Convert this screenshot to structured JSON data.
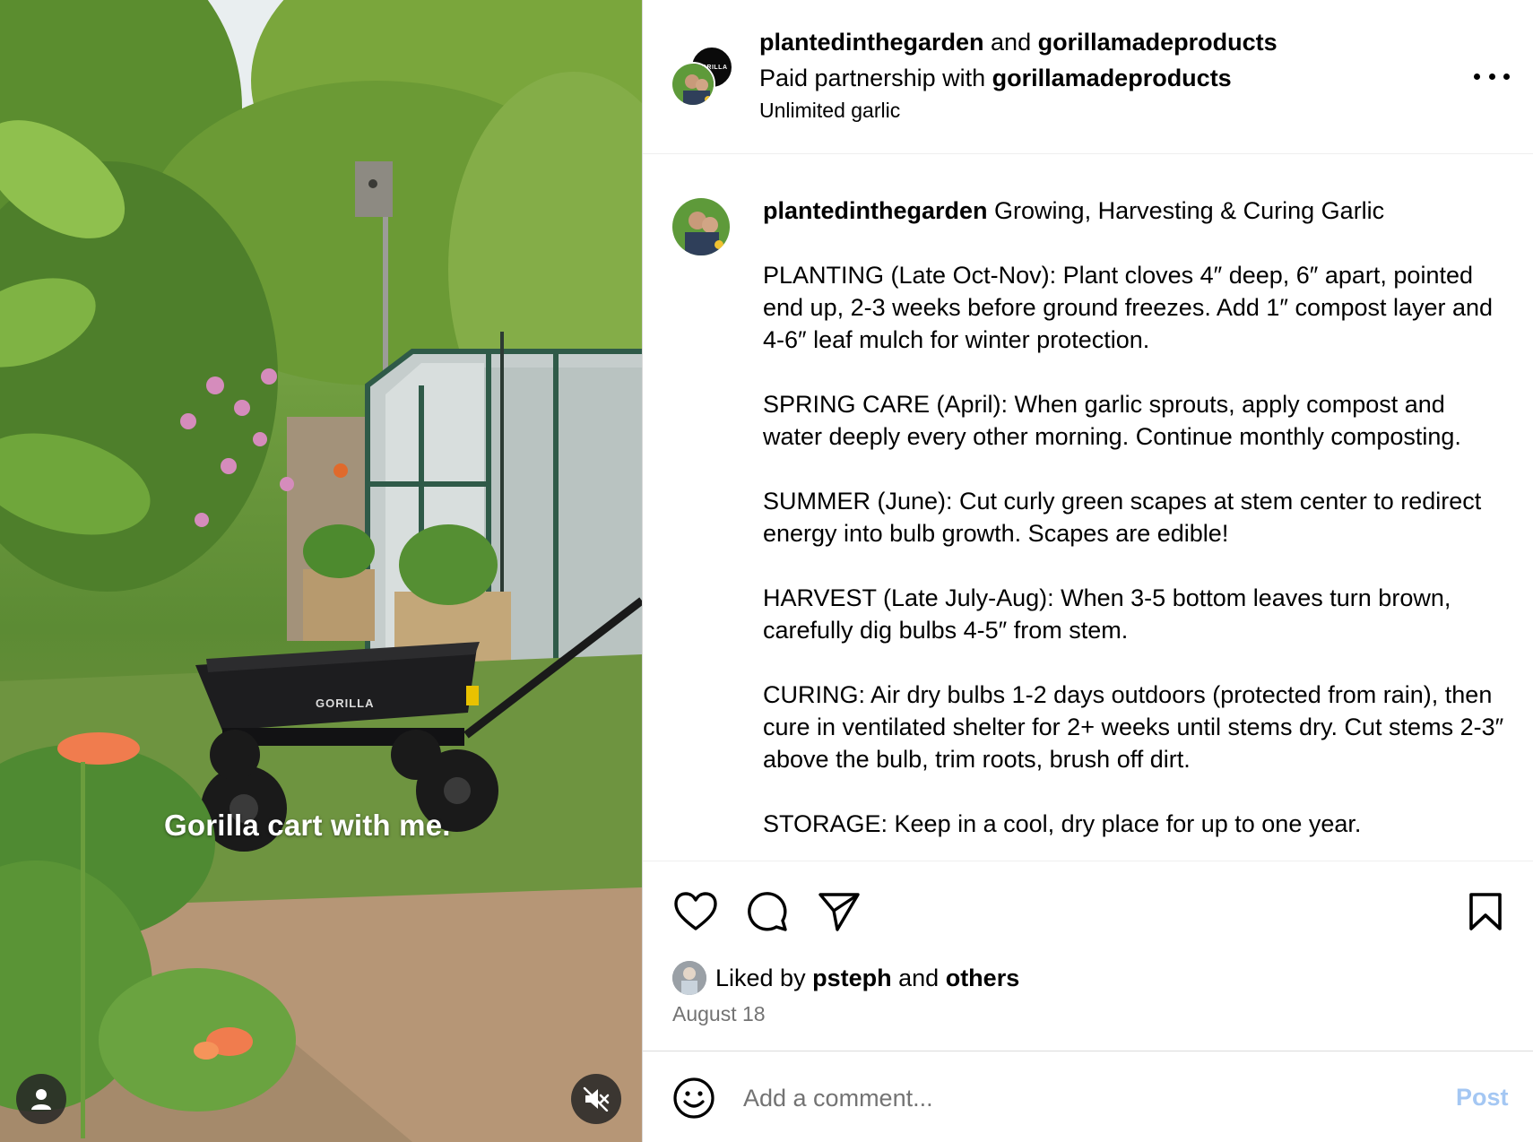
{
  "media": {
    "caption_overlay": "Gorilla cart with me.",
    "cart_brand_label": "GORILLA",
    "user_tag_icon": "user-icon",
    "mute_icon": "speaker-muted-icon"
  },
  "header": {
    "author": "plantedinthegarden",
    "joiner": "and",
    "coauthor": "gorillamadeproducts",
    "partnership_prefix": "Paid partnership with",
    "partnership_brand": "gorillamadeproducts",
    "audio": "Unlimited garlic",
    "brand_avatar_text": "GORILLA",
    "more_icon": "more-horizontal-icon"
  },
  "caption": {
    "username": "plantedinthegarden",
    "title": "Growing, Harvesting & Curing Garlic",
    "paragraphs": [
      "PLANTING (Late Oct-Nov): Plant cloves 4″ deep, 6″ apart, pointed end up, 2-3 weeks before ground freezes. Add 1″ compost layer and 4-6″ leaf mulch for winter protection.",
      "SPRING CARE (April): When garlic sprouts, apply compost and water deeply every other morning. Continue monthly composting.",
      "SUMMER (June): Cut curly green scapes at stem center to redirect energy into bulb growth. Scapes are edible!",
      "HARVEST (Late July-Aug): When 3-5 bottom leaves turn brown, carefully dig bulbs 4-5″ from stem.",
      "CURING: Air dry bulbs 1-2 days outdoors (protected from rain), then cure in ventilated shelter for 2+ weeks until stems dry. Cut stems 2-3″ above the bulb, trim roots, brush off dirt.",
      "STORAGE: Keep in a cool, dry place for up to one year."
    ]
  },
  "actions": {
    "like_icon": "heart-icon",
    "comment_icon": "comment-icon",
    "share_icon": "paper-plane-icon",
    "save_icon": "bookmark-icon"
  },
  "likes": {
    "prefix": "Liked by",
    "user": "psteph",
    "joiner": "and",
    "others": "others"
  },
  "date": "August 18",
  "comment": {
    "placeholder": "Add a comment...",
    "post_label": "Post",
    "emoji_icon": "smiley-icon"
  },
  "colors": {
    "post_button": "#a4c7f3",
    "secondary_text": "#737373",
    "divider": "#dbdbdb"
  }
}
